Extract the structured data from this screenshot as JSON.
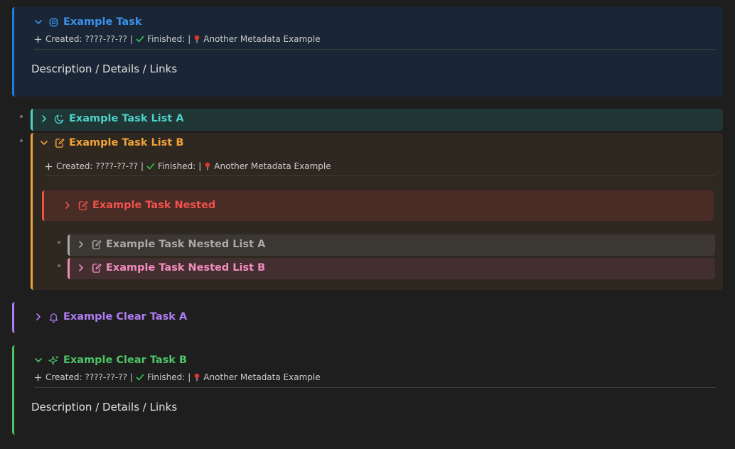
{
  "meta": {
    "created_label": "Created:",
    "created_value": "????-??-??",
    "separator": "|",
    "finished_label": "Finished:",
    "extra_label": "Another Metadata Example"
  },
  "description_text": "Description / Details / Links",
  "tasks": {
    "example_task": {
      "title": "Example Task",
      "color": "#1e7fe0",
      "icon": "cpu-icon",
      "expanded": true
    },
    "list_a": {
      "title": "Example Task List A",
      "color": "#4dd0c8",
      "icon": "moon-icon",
      "expanded": false
    },
    "list_b": {
      "title": "Example Task List B",
      "color": "#f0a23a",
      "icon": "notebook-pen-icon",
      "expanded": true
    },
    "nested": {
      "title": "Example Task Nested",
      "color": "#f0524a",
      "icon": "notebook-pen-icon",
      "expanded": false
    },
    "nested_list_a": {
      "title": "Example Task Nested List A",
      "color": "#a8a8a8",
      "icon": "notebook-pen-icon",
      "expanded": false
    },
    "nested_list_b": {
      "title": "Example Task Nested List B",
      "color": "#f28cbf",
      "icon": "notebook-pen-icon",
      "expanded": false
    },
    "clear_a": {
      "title": "Example Clear Task A",
      "color": "#b07cf5",
      "icon": "bell-icon",
      "expanded": false
    },
    "clear_b": {
      "title": "Example Clear Task B",
      "color": "#4cc466",
      "icon": "sparkles-icon",
      "expanded": true
    }
  }
}
